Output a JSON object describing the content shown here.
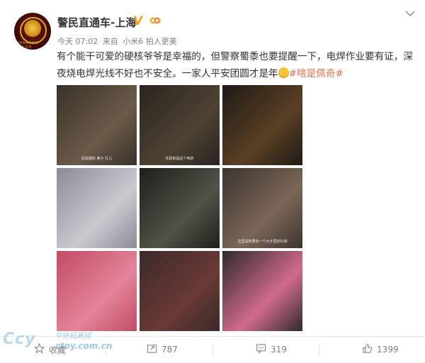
{
  "post": {
    "author": "警民直通车-上海",
    "verified": "V",
    "time": "今天 07:02",
    "from_label": "来自",
    "device": "小米6 拍人更美",
    "text_main": "有个能干可爱的硬核爷爷是幸福的，但警察蜀黍也要提醒一下，电焊作业要有证，深夜烧电焊光线不好也不安全。一家人平安团圆才是年",
    "topic": "#啥是佩奇#",
    "avatar_label": "SHANGHAI POLICE",
    "more_icon": "chevron-down-icon"
  },
  "photos": [
    {
      "caption": "这是图的 鼻子 孔儿",
      "colors": [
        "#3a3128",
        "#6b5a48"
      ]
    },
    {
      "caption": "先焊就是这个电的",
      "colors": [
        "#2a2420",
        "#4e4232"
      ]
    },
    {
      "caption": "",
      "colors": [
        "#1e1a16",
        "#5a4024"
      ]
    },
    {
      "caption": "",
      "colors": [
        "#8a8d96",
        "#c9cad0"
      ]
    },
    {
      "caption": "",
      "colors": [
        "#1d1f1c",
        "#505346"
      ]
    },
    {
      "caption": "这里是你要的一个大手里的礼物",
      "colors": [
        "#3b3530",
        "#7a6656"
      ]
    },
    {
      "caption": "",
      "colors": [
        "#c24c62",
        "#e3849a"
      ]
    },
    {
      "caption": "",
      "colors": [
        "#3a2a2a",
        "#6a3a34"
      ]
    },
    {
      "caption": "",
      "colors": [
        "#2e2a2c",
        "#d26a8c"
      ]
    }
  ],
  "watermark": {
    "logo": "Ccy",
    "sub": "中外玩具网",
    "url": "ctoy.com.cn"
  },
  "actions": {
    "favorite": "收藏",
    "repost": "787",
    "comment": "319",
    "like": "1399"
  }
}
